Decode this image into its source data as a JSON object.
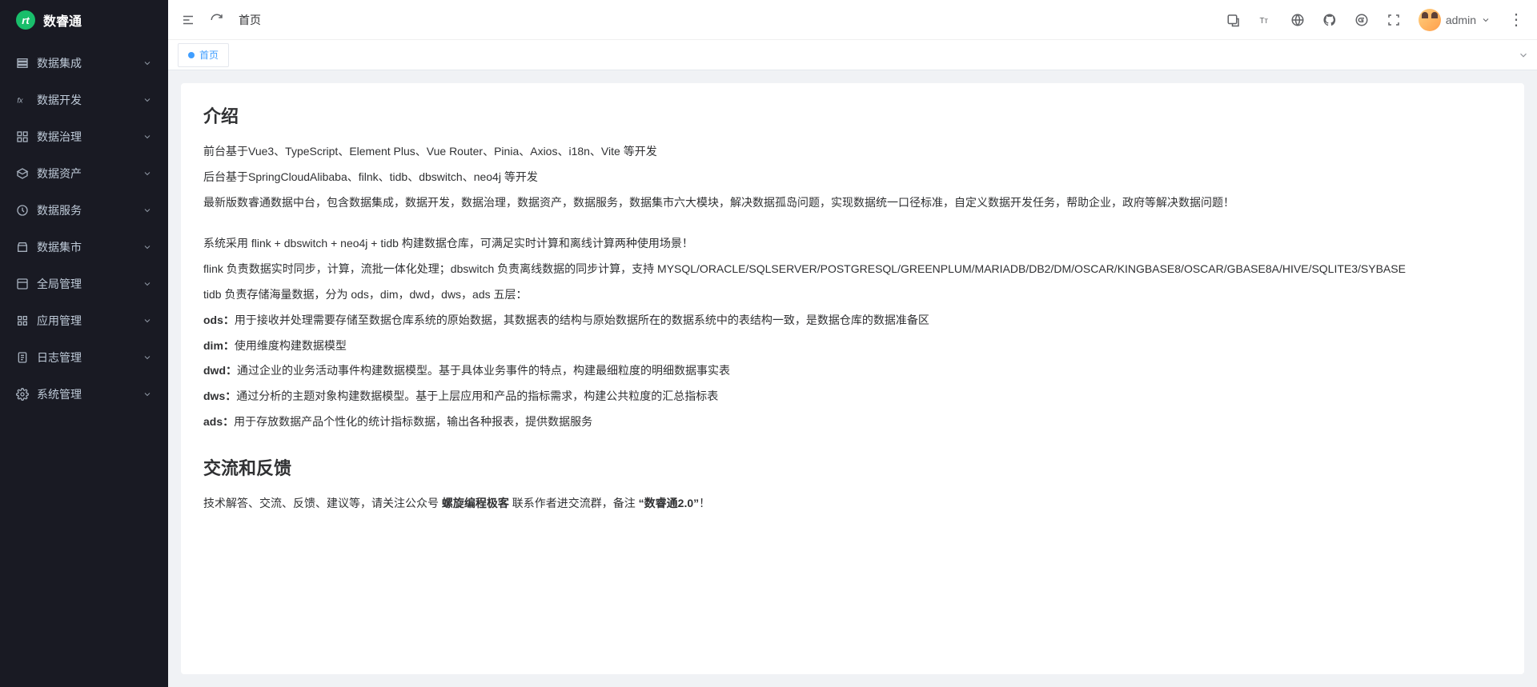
{
  "app": {
    "logo_text": "数睿通",
    "logo_badge": "rt"
  },
  "sidebar": {
    "items": [
      {
        "label": "数据集成",
        "icon": "layers-icon"
      },
      {
        "label": "数据开发",
        "icon": "fx-icon"
      },
      {
        "label": "数据治理",
        "icon": "grid-icon"
      },
      {
        "label": "数据资产",
        "icon": "box-icon"
      },
      {
        "label": "数据服务",
        "icon": "service-icon"
      },
      {
        "label": "数据集市",
        "icon": "market-icon"
      },
      {
        "label": "全局管理",
        "icon": "global-icon"
      },
      {
        "label": "应用管理",
        "icon": "app-icon"
      },
      {
        "label": "日志管理",
        "icon": "log-icon"
      },
      {
        "label": "系统管理",
        "icon": "gear-icon"
      }
    ]
  },
  "topbar": {
    "breadcrumb": "首页",
    "user": "admin"
  },
  "tabs": {
    "active": "首页"
  },
  "content": {
    "h_intro": "介绍",
    "p1": "前台基于Vue3、TypeScript、Element Plus、Vue Router、Pinia、Axios、i18n、Vite 等开发",
    "p2": "后台基于SpringCloudAlibaba、filnk、tidb、dbswitch、neo4j 等开发",
    "p3": "最新版数睿通数据中台，包含数据集成，数据开发，数据治理，数据资产，数据服务，数据集市六大模块，解决数据孤岛问题，实现数据统一口径标准，自定义数据开发任务，帮助企业，政府等解决数据问题！",
    "p4": "系统采用 flink + dbswitch + neo4j + tidb 构建数据仓库，可满足实时计算和离线计算两种使用场景！",
    "p5": "flink 负责数据实时同步，计算，流批一体化处理；dbswitch 负责离线数据的同步计算，支持 MYSQL/ORACLE/SQLSERVER/POSTGRESQL/GREENPLUM/MARIADB/DB2/DM/OSCAR/KINGBASE8/OSCAR/GBASE8A/HIVE/SQLITE3/SYBASE",
    "p6": "tidb 负责存储海量数据，分为 ods，dim，dwd，dws，ads 五层：",
    "p7_b": "ods：",
    "p7_t": "用于接收并处理需要存储至数据仓库系统的原始数据，其数据表的结构与原始数据所在的数据系统中的表结构一致，是数据仓库的数据准备区",
    "p8_b": "dim：",
    "p8_t": "使用维度构建数据模型",
    "p9_b": "dwd：",
    "p9_t": "通过企业的业务活动事件构建数据模型。基于具体业务事件的特点，构建最细粒度的明细数据事实表",
    "p10_b": "dws：",
    "p10_t": "通过分析的主题对象构建数据模型。基于上层应用和产品的指标需求，构建公共粒度的汇总指标表",
    "p11_b": "ads：",
    "p11_t": "用于存放数据产品个性化的统计指标数据，输出各种报表，提供数据服务",
    "h_feedback": "交流和反馈",
    "fb_pre": "技术解答、交流、反馈、建议等，请关注公众号 ",
    "fb_b1": "螺旋编程极客",
    "fb_mid": " 联系作者进交流群，备注 ",
    "fb_b2": "“数睿通2.0”",
    "fb_post": "！"
  }
}
